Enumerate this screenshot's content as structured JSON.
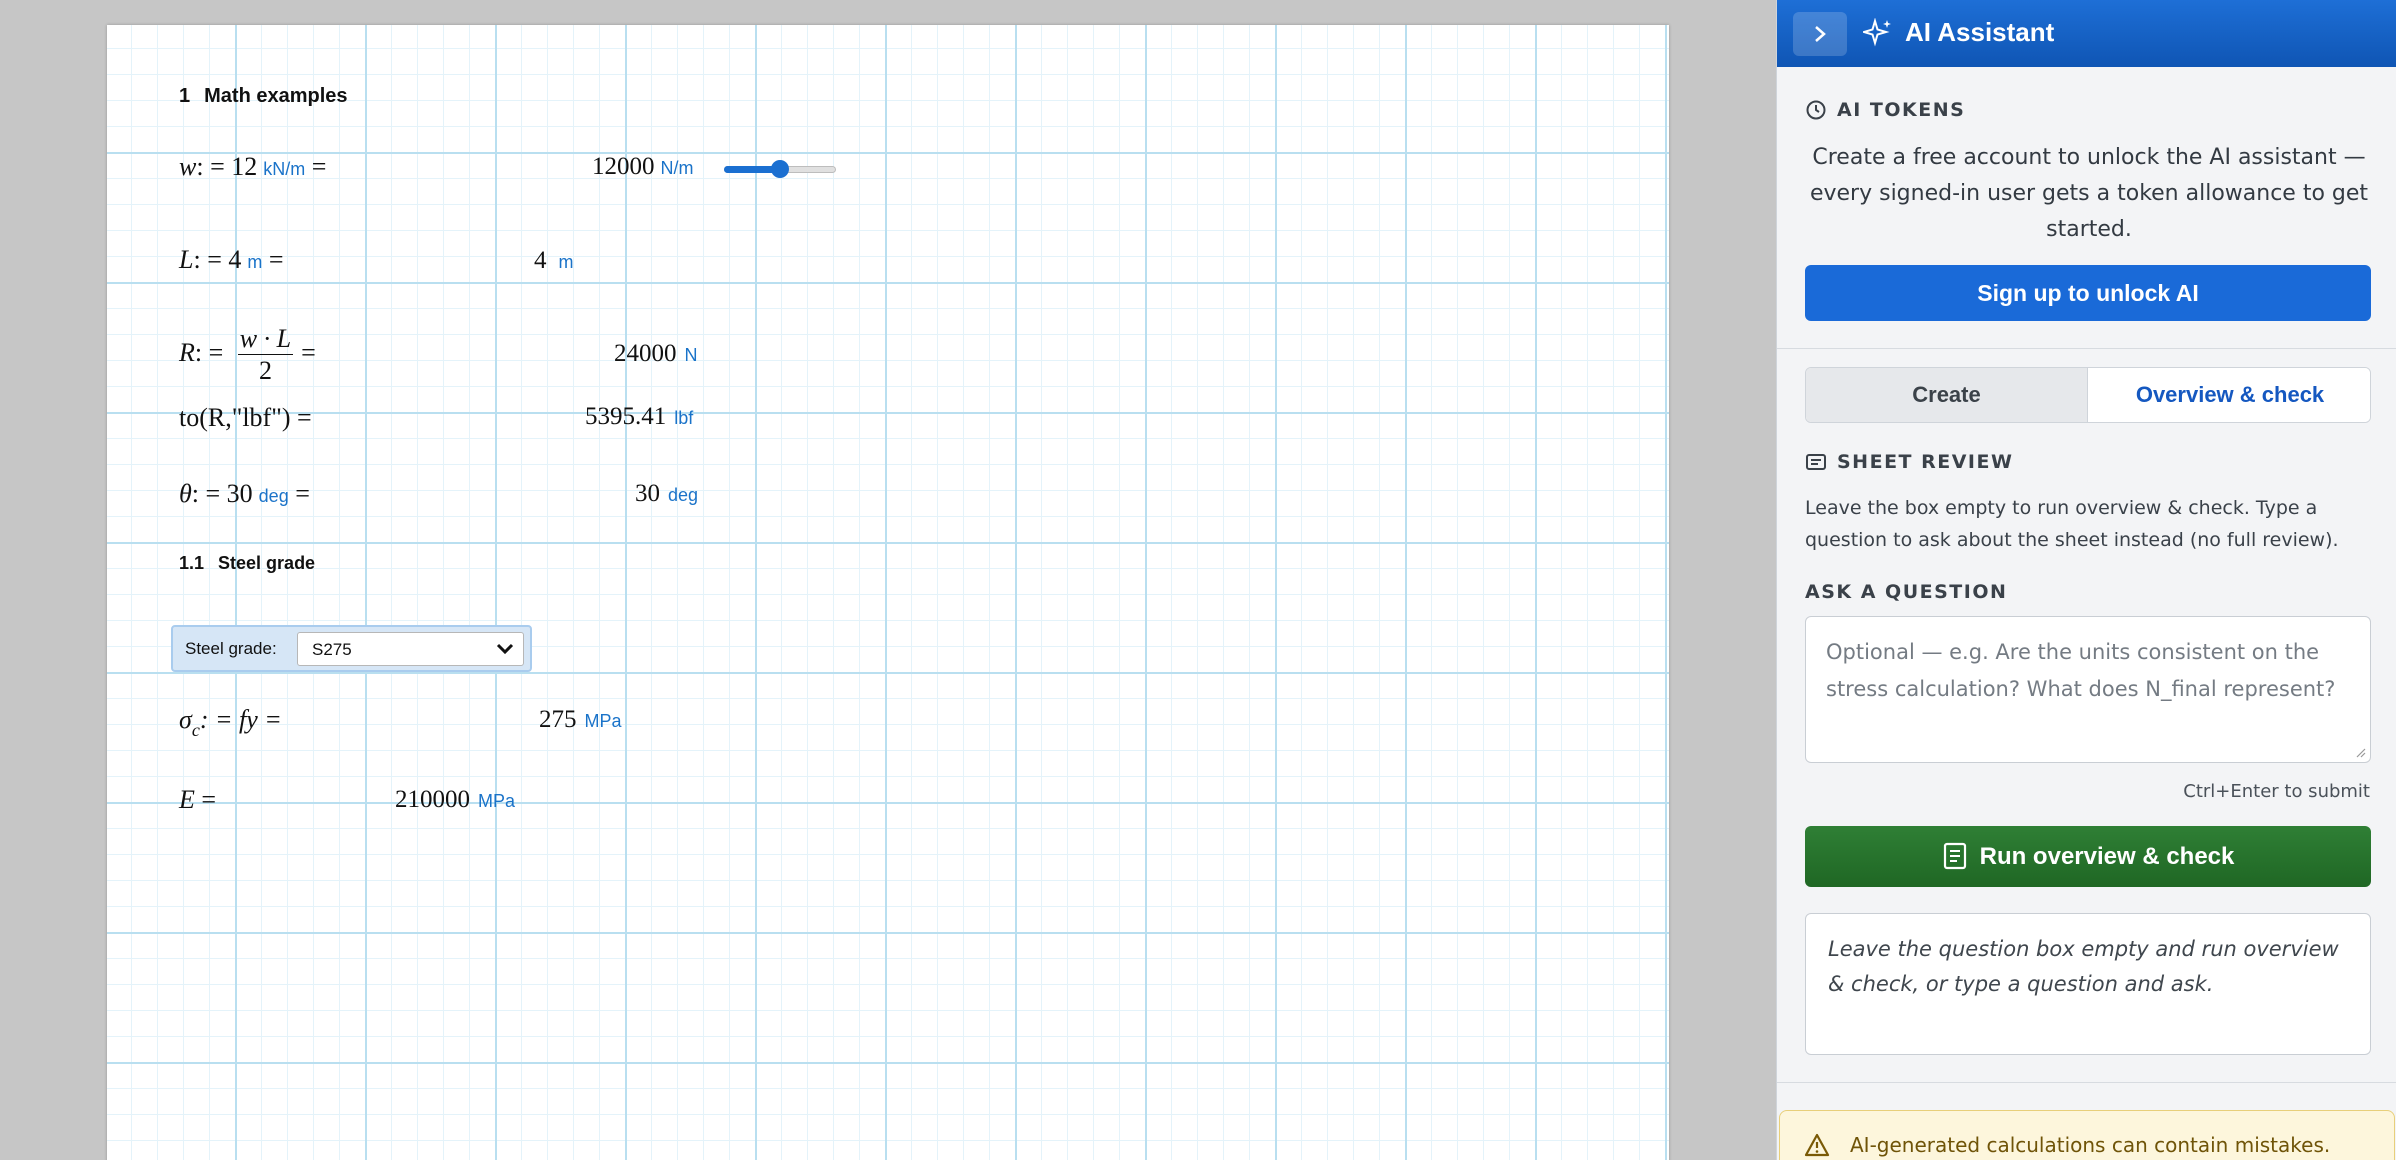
{
  "worksheet": {
    "heading1": {
      "number": "1",
      "title": "Math examples"
    },
    "heading2": {
      "number": "1.1",
      "title": "Steel grade"
    },
    "eq_w": {
      "var": "w",
      "assign": ": = ",
      "value": "12",
      "unit": "kN/m",
      "equals": "=",
      "result": "12000",
      "result_unit": "N/m",
      "slider_fraction": 0.5
    },
    "eq_L": {
      "var": "L",
      "assign": ": = ",
      "value": "4",
      "unit": "m",
      "equals": "=",
      "result": "4",
      "result_unit": "m"
    },
    "eq_R": {
      "var": "R",
      "assign": ": = ",
      "numerator": "w · L",
      "denominator": "2",
      "equals": "=",
      "result": "24000",
      "result_unit": "N"
    },
    "eq_to": {
      "expr": "to(R,\"lbf\") =",
      "result": "5395.41",
      "result_unit": "lbf"
    },
    "eq_theta": {
      "var": "θ",
      "assign": ": = ",
      "value": "30",
      "unit": "deg",
      "equals": "=",
      "result": "30",
      "result_unit": "deg"
    },
    "dropdown": {
      "label": "Steel grade:",
      "value": "S275"
    },
    "eq_sigma": {
      "var": "σ",
      "sub": "c",
      "rest": ": = fy =",
      "result": "275",
      "result_unit": "MPa"
    },
    "eq_E": {
      "var": "E",
      "equals": "=",
      "result": "210000",
      "result_unit": "MPa"
    }
  },
  "panel": {
    "title": "AI Assistant",
    "tokens_label": "AI TOKENS",
    "tokens_text": "Create a free account to unlock the AI assistant — every signed-in user gets a token allowance to get started.",
    "signup_label": "Sign up to unlock AI",
    "tabs": [
      {
        "label": "Create",
        "active": false
      },
      {
        "label": "Overview & check",
        "active": true
      }
    ],
    "review_label": "SHEET REVIEW",
    "review_text": "Leave the box empty to run overview & check. Type a question to ask about the sheet instead (no full review).",
    "question_label": "ASK A QUESTION",
    "question_placeholder": "Optional — e.g. Are the units consistent on the stress calculation? What does N_final represent?",
    "hint": "Ctrl+Enter to submit",
    "run_label": "Run overview & check",
    "result_text": "Leave the question box empty and run overview & check, or type a question and ask.",
    "warning_text": "AI-generated calculations can contain mistakes."
  },
  "colors": {
    "accent_blue": "#1a6ad8",
    "header_blue": "#1e6fd6",
    "run_green": "#2f7f35",
    "unit_blue": "#1a73c9",
    "warning_bg": "#fdf6dc"
  },
  "icons": [
    "chevron-right-icon",
    "sparkle-icon",
    "clock-icon",
    "list-card-icon",
    "document-icon",
    "warning-triangle-icon",
    "chevron-down-icon"
  ]
}
